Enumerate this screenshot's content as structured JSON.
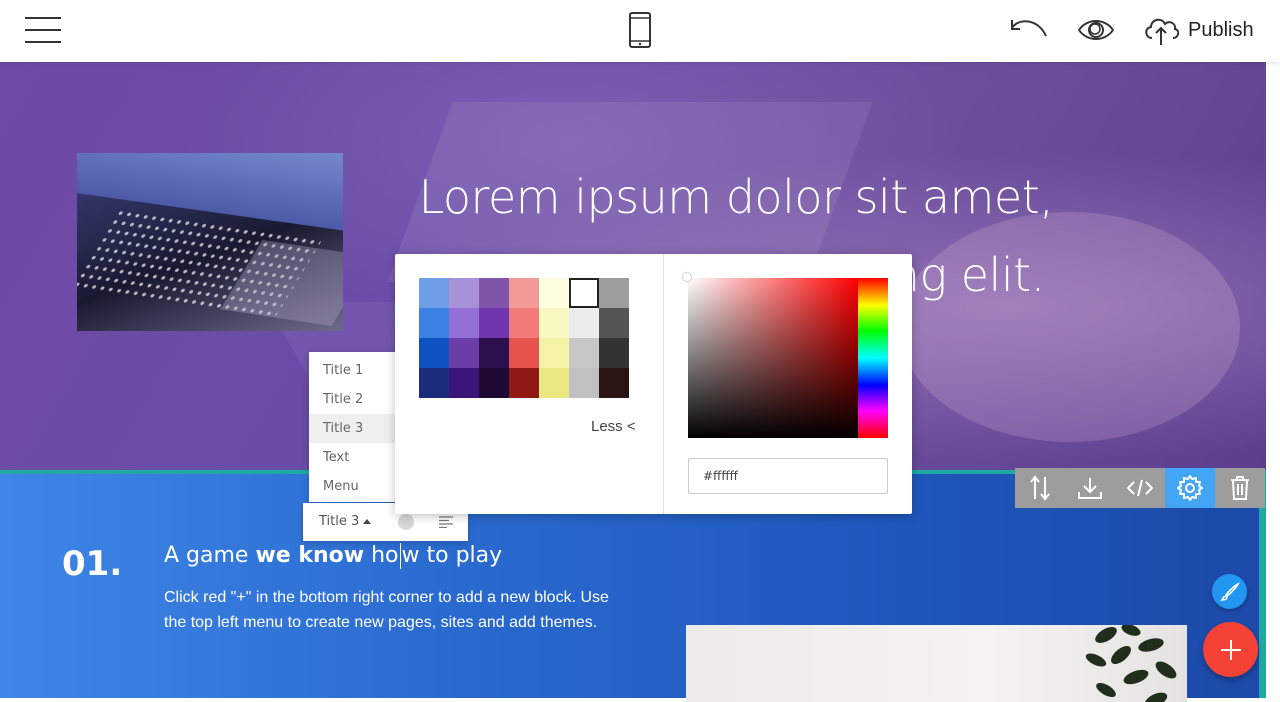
{
  "topbar": {
    "menu_icon": "hamburger-icon",
    "device_icon": "mobile-phone-icon",
    "undo_icon": "undo-icon",
    "preview_icon": "eye-icon",
    "publish_icon": "cloud-upload-icon",
    "publish_label": "Publish"
  },
  "hero": {
    "title": "Lorem ipsum dolor sit amet, consectetur adipisicing elit."
  },
  "feature": {
    "number": "01.",
    "heading_pre": "A game ",
    "heading_bold": "we know",
    "heading_mid": " ho",
    "heading_post": "w to play",
    "body": "Click red \"+\" in the bottom right corner to add a new block. Use the top left menu to create new pages, sites and add themes."
  },
  "text_style_menu": {
    "items": [
      "Title 1",
      "Title 2",
      "Title 3",
      "Text",
      "Menu"
    ],
    "selected_index": 2
  },
  "text_toolbar": {
    "style_label": "Title 3",
    "align_icon": "align-left-icon"
  },
  "color_picker": {
    "swatch_colors": [
      "#6f9ee6",
      "#a792d8",
      "#8155a9",
      "#f19b99",
      "#fffee0",
      "#ffffff",
      "#9e9e9e",
      "#3d81e4",
      "#9270d6",
      "#7135ad",
      "#f27a78",
      "#f9f8c2",
      "#ececec",
      "#545454",
      "#0f53c3",
      "#6a3ea6",
      "#2c0f4d",
      "#e5534e",
      "#f4f3a6",
      "#c7c7c7",
      "#333333",
      "#1b2c7a",
      "#3a1679",
      "#1e0a35",
      "#8f1a14",
      "#e9e881",
      "#c0c0c0",
      "#2a1514"
    ],
    "selected_color": "#ffffff",
    "less_label": "Less <",
    "hue_color": "#ff0000",
    "hex_value": "#ffffff"
  },
  "block_toolbar": {
    "icons": [
      "move-updown-icon",
      "save-block-icon",
      "code-icon",
      "gear-icon",
      "trash-icon"
    ],
    "active_icon": "gear-icon",
    "active_color": "#42a5f5"
  },
  "floating": {
    "brush_icon": "paint-brush-icon",
    "add_icon": "plus-icon",
    "add_color": "#f44336"
  }
}
